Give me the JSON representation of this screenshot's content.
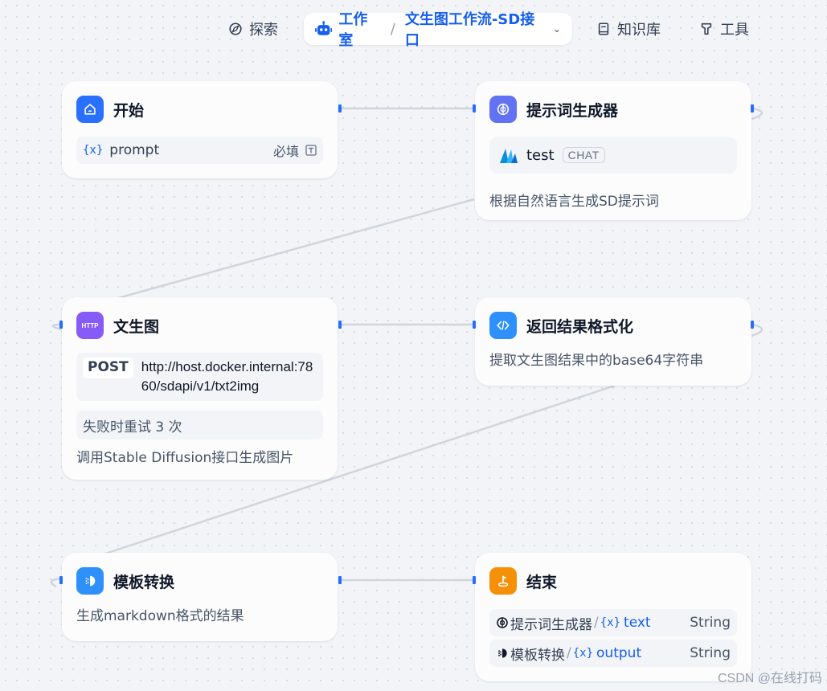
{
  "nav": {
    "explore": "探索",
    "studio": "工作室",
    "app_name": "文生图工作流-SD接口",
    "knowledge": "知识库",
    "tools": "工具"
  },
  "nodes": {
    "start": {
      "title": "开始",
      "var_icon": "{x}",
      "var_name": "prompt",
      "required": "必填"
    },
    "prompt_gen": {
      "title": "提示词生成器",
      "model": "test",
      "model_mode": "CHAT",
      "desc": "根据自然语言生成SD提示词"
    },
    "txt2img": {
      "icon_label": "HTTP",
      "title": "文生图",
      "method": "POST",
      "url": "http://host.docker.internal:7860/sdapi/v1/txt2img",
      "retry": "失败时重试 3 次",
      "desc": "调用Stable Diffusion接口生成图片"
    },
    "format": {
      "title": "返回结果格式化",
      "desc": "提取文生图结果中的base64字符串"
    },
    "template": {
      "title": "模板转换",
      "desc": "生成markdown格式的结果"
    },
    "end": {
      "title": "结束",
      "outputs": [
        {
          "source": "提示词生成器",
          "var_icon": "{x}",
          "var": "text",
          "type": "String"
        },
        {
          "source": "模板转换",
          "var_icon": "{x}",
          "var": "output",
          "type": "String"
        }
      ]
    }
  },
  "colors": {
    "start": "#2970ff",
    "prompt_gen": "#6172f3",
    "txt2img": "#875bf7",
    "format": "#2e90fa",
    "template": "#2e90fa",
    "end": "#f79009",
    "accent": "#155eef"
  },
  "watermark": "CSDN @在线打码"
}
